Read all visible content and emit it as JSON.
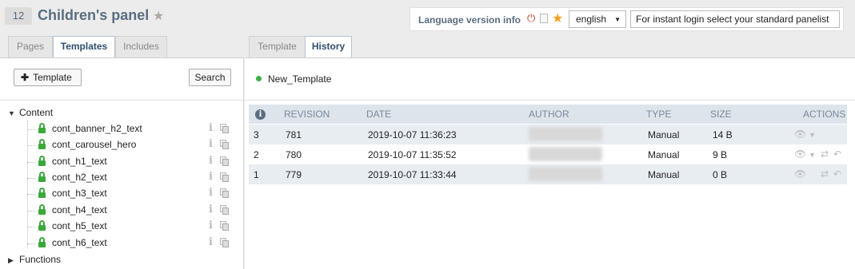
{
  "header": {
    "panel_id": "12",
    "panel_title": "Children's panel",
    "language_label": "Language version info",
    "language_selected": "english",
    "login_placeholder": "For instant login select your standard panelist"
  },
  "left_tabs": [
    {
      "label": "Pages",
      "active": false
    },
    {
      "label": "Templates",
      "active": true
    },
    {
      "label": "Includes",
      "active": false
    }
  ],
  "right_tabs": [
    {
      "label": "Template",
      "active": false
    },
    {
      "label": "History",
      "active": true
    }
  ],
  "left_toolbar": {
    "add_template_label": "Template",
    "search_label": "Search"
  },
  "tree": {
    "folders": [
      {
        "label": "Content",
        "expanded": true
      },
      {
        "label": "Functions",
        "expanded": false
      }
    ],
    "items": [
      {
        "label": "cont_banner_h2_text"
      },
      {
        "label": "cont_carousel_hero"
      },
      {
        "label": "cont_h1_text"
      },
      {
        "label": "cont_h2_text"
      },
      {
        "label": "cont_h3_text"
      },
      {
        "label": "cont_h4_text"
      },
      {
        "label": "cont_h5_text"
      },
      {
        "label": "cont_h6_text"
      }
    ]
  },
  "template_header": {
    "name": "New_Template",
    "status_color": "#3cb043"
  },
  "history": {
    "columns": [
      "REVISION",
      "DATE",
      "AUTHOR",
      "TYPE",
      "SIZE",
      "ACTIONS"
    ],
    "rows": [
      {
        "index": "3",
        "revision": "781",
        "date": "2019-10-07 11:36:23",
        "type": "Manual",
        "size": "14 B"
      },
      {
        "index": "2",
        "revision": "780",
        "date": "2019-10-07 11:35:52",
        "type": "Manual",
        "size": "9 B"
      },
      {
        "index": "1",
        "revision": "779",
        "date": "2019-10-07 11:33:44",
        "type": "Manual",
        "size": "0 B"
      }
    ]
  },
  "colors": {
    "accent": "#5a6d80",
    "lock_green": "#3aa83a",
    "favorite_orange": "#f0a020",
    "power_red": "#c0392b"
  }
}
